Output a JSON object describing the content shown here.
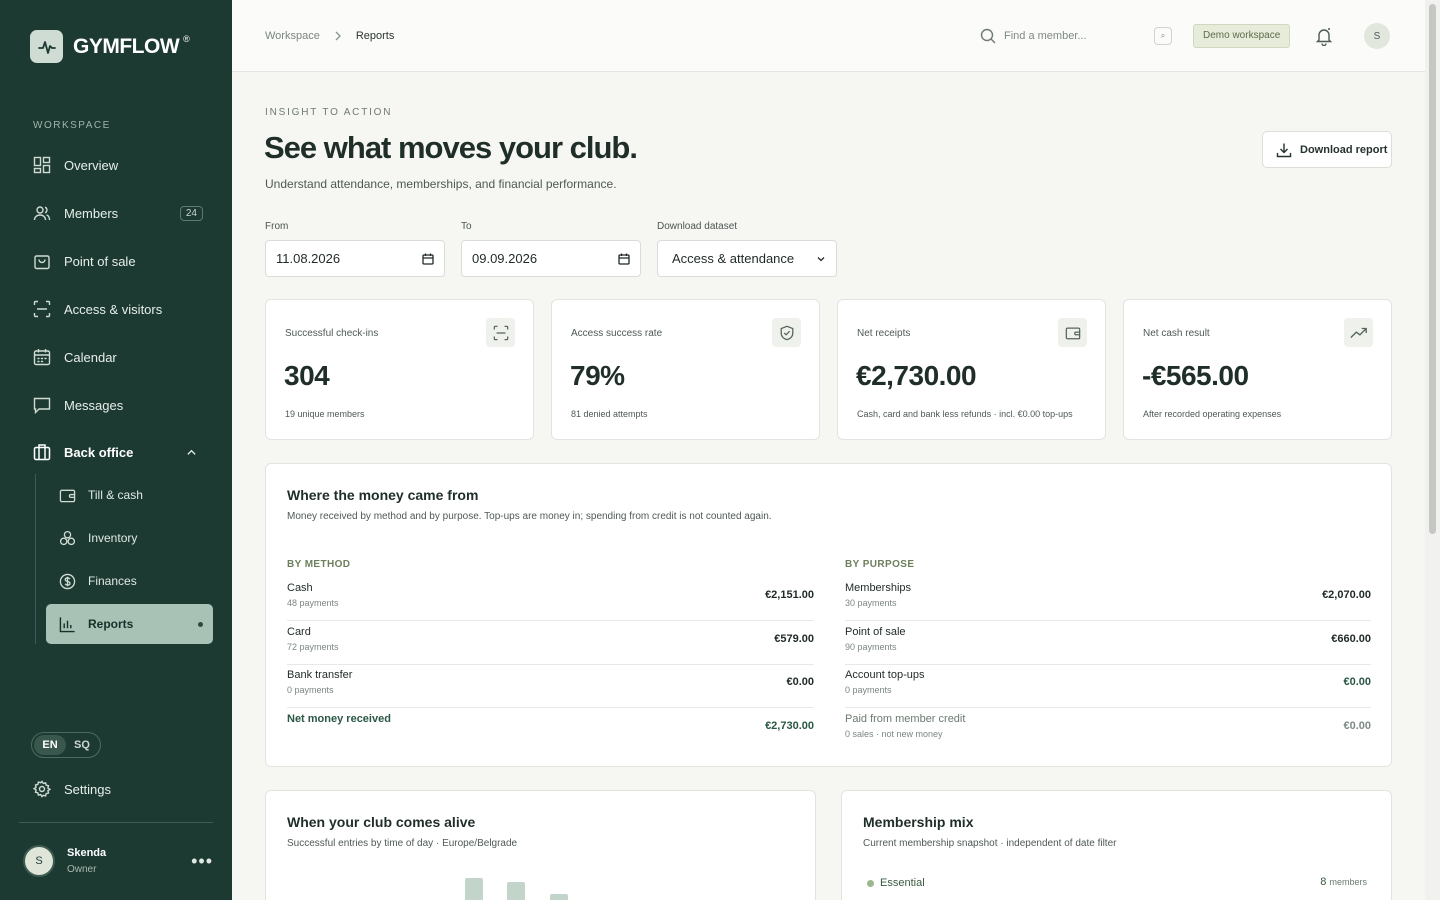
{
  "brand": {
    "name": "GYMFLOW",
    "reg": "®"
  },
  "sidebar": {
    "section_label": "WORKSPACE",
    "items": [
      {
        "label": "Overview",
        "icon": "grid-icon"
      },
      {
        "label": "Members",
        "icon": "users-icon",
        "badge": "24"
      },
      {
        "label": "Point of sale",
        "icon": "shopping-bag-icon"
      },
      {
        "label": "Access & visitors",
        "icon": "scan-icon"
      },
      {
        "label": "Calendar",
        "icon": "calendar-icon"
      },
      {
        "label": "Messages",
        "icon": "message-icon"
      },
      {
        "label": "Back office",
        "icon": "briefcase-icon"
      }
    ],
    "sub_items": [
      {
        "label": "Till & cash",
        "icon": "wallet-icon"
      },
      {
        "label": "Inventory",
        "icon": "boxes-icon"
      },
      {
        "label": "Finances",
        "icon": "dollar-icon"
      },
      {
        "label": "Reports",
        "icon": "bar-chart-icon"
      }
    ],
    "lang": {
      "en": "EN",
      "sq": "SQ"
    },
    "settings": "Settings",
    "user": {
      "initial": "S",
      "name": "Skenda",
      "role": "Owner"
    }
  },
  "topbar": {
    "crumbs": [
      "Workspace",
      "Reports"
    ],
    "search_placeholder": "Find a member...",
    "kbd": "⌕",
    "demo": "Demo workspace",
    "avatar": "S"
  },
  "header": {
    "eyebrow": "INSIGHT TO ACTION",
    "title": "See what moves your club.",
    "subtitle": "Understand attendance, memberships, and financial performance.",
    "download": "Download report"
  },
  "filters": {
    "from_label": "From",
    "from_value": "11.08.2026",
    "to_label": "To",
    "to_value": "09.09.2026",
    "dataset_label": "Download dataset",
    "dataset_value": "Access & attendance"
  },
  "kpis": [
    {
      "label": "Successful check-ins",
      "value": "304",
      "note": "19 unique members",
      "icon": "scan-icon"
    },
    {
      "label": "Access success rate",
      "value": "79%",
      "note": "81 denied attempts",
      "icon": "shield-check-icon"
    },
    {
      "label": "Net receipts",
      "value": "€2,730.00",
      "note": "Cash, card and bank less refunds · incl. €0.00 top-ups",
      "icon": "wallet-icon"
    },
    {
      "label": "Net cash result",
      "value": "-€565.00",
      "note": "After recorded operating expenses",
      "icon": "trend-up-icon"
    }
  ],
  "money": {
    "title": "Where the money came from",
    "subtitle": "Money received by method and by purpose. Top-ups are money in; spending from credit is not counted again.",
    "by_method_label": "BY METHOD",
    "by_purpose_label": "BY PURPOSE",
    "by_method": [
      {
        "label": "Cash",
        "sub": "48 payments",
        "value": "€2,151.00"
      },
      {
        "label": "Card",
        "sub": "72 payments",
        "value": "€579.00"
      },
      {
        "label": "Bank transfer",
        "sub": "0 payments",
        "value": "€0.00"
      },
      {
        "label": "Net money received",
        "sub": "",
        "value": "€2,730.00"
      }
    ],
    "by_purpose": [
      {
        "label": "Memberships",
        "sub": "30 payments",
        "value": "€2,070.00"
      },
      {
        "label": "Point of sale",
        "sub": "90 payments",
        "value": "€660.00"
      },
      {
        "label": "Account top-ups",
        "sub": "0 payments",
        "value": "€0.00"
      },
      {
        "label": "Paid from member credit",
        "sub": "0 sales · not new money",
        "value": "€0.00"
      }
    ]
  },
  "alive": {
    "title": "When your club comes alive",
    "subtitle": "Successful entries by time of day · Europe/Belgrade"
  },
  "mix": {
    "title": "Membership mix",
    "subtitle": "Current membership snapshot · independent of date filter",
    "first_label": "Essential",
    "first_count": "8",
    "first_unit": "members"
  },
  "colors": {
    "sidebar": "#1d3a32",
    "accent": "#a8c3b5",
    "brand_green": "#2b5744"
  }
}
